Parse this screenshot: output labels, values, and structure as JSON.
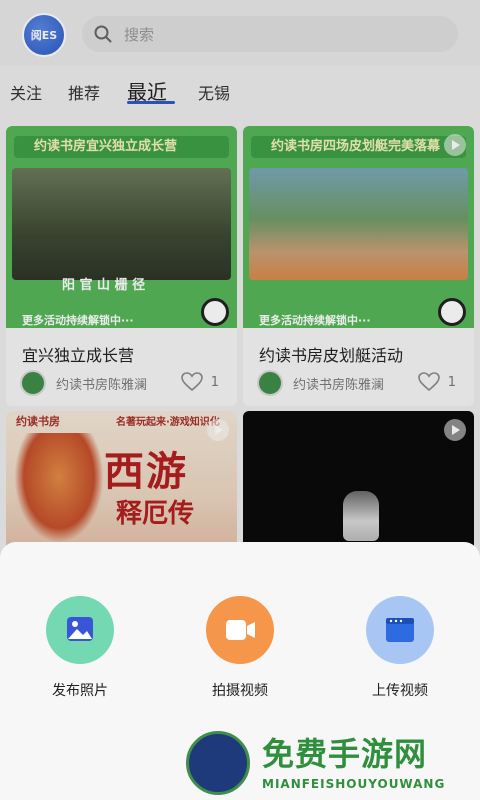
{
  "header": {
    "logo_text": "阅ES",
    "search_placeholder": "搜索"
  },
  "tabs": [
    {
      "label": "关注"
    },
    {
      "label": "推荐"
    },
    {
      "label": "最近"
    },
    {
      "label": "无锡"
    }
  ],
  "active_tab": "最近",
  "feed": [
    {
      "banner": "约读书房宜兴独立成长营",
      "caption": "阳 官 山 栅 径",
      "footer": "更多活动持续解锁中···",
      "title": "宜兴独立成长营",
      "author": "约读书房陈雅澜",
      "likes": "1"
    },
    {
      "banner": "约读书房四场皮划艇完美落幕",
      "footer": "更多活动持续解锁中···",
      "title": "约读书房皮划艇活动",
      "author": "约读书房陈雅澜",
      "likes": "1"
    },
    {
      "poster_head": "约读书房",
      "poster_tag": "名著玩起来·游戏知识化",
      "poster_title": "西游",
      "poster_sub": "释厄传"
    },
    {}
  ],
  "sheet": {
    "actions": [
      {
        "label": "发布照片",
        "icon": "photo-icon",
        "color": "#74d8b2"
      },
      {
        "label": "拍摄视频",
        "icon": "video-camera-icon",
        "color": "#f5964a"
      },
      {
        "label": "上传视频",
        "icon": "upload-video-icon",
        "color": "#a8c6f3"
      }
    ]
  },
  "watermark": {
    "title": "免费手游网",
    "subtitle": "MIANFEISHOUYOUWANG"
  },
  "colors": {
    "accent": "#2d5bc6",
    "banner_green": "#56b65a",
    "watermark_green": "#2f8f3d"
  }
}
